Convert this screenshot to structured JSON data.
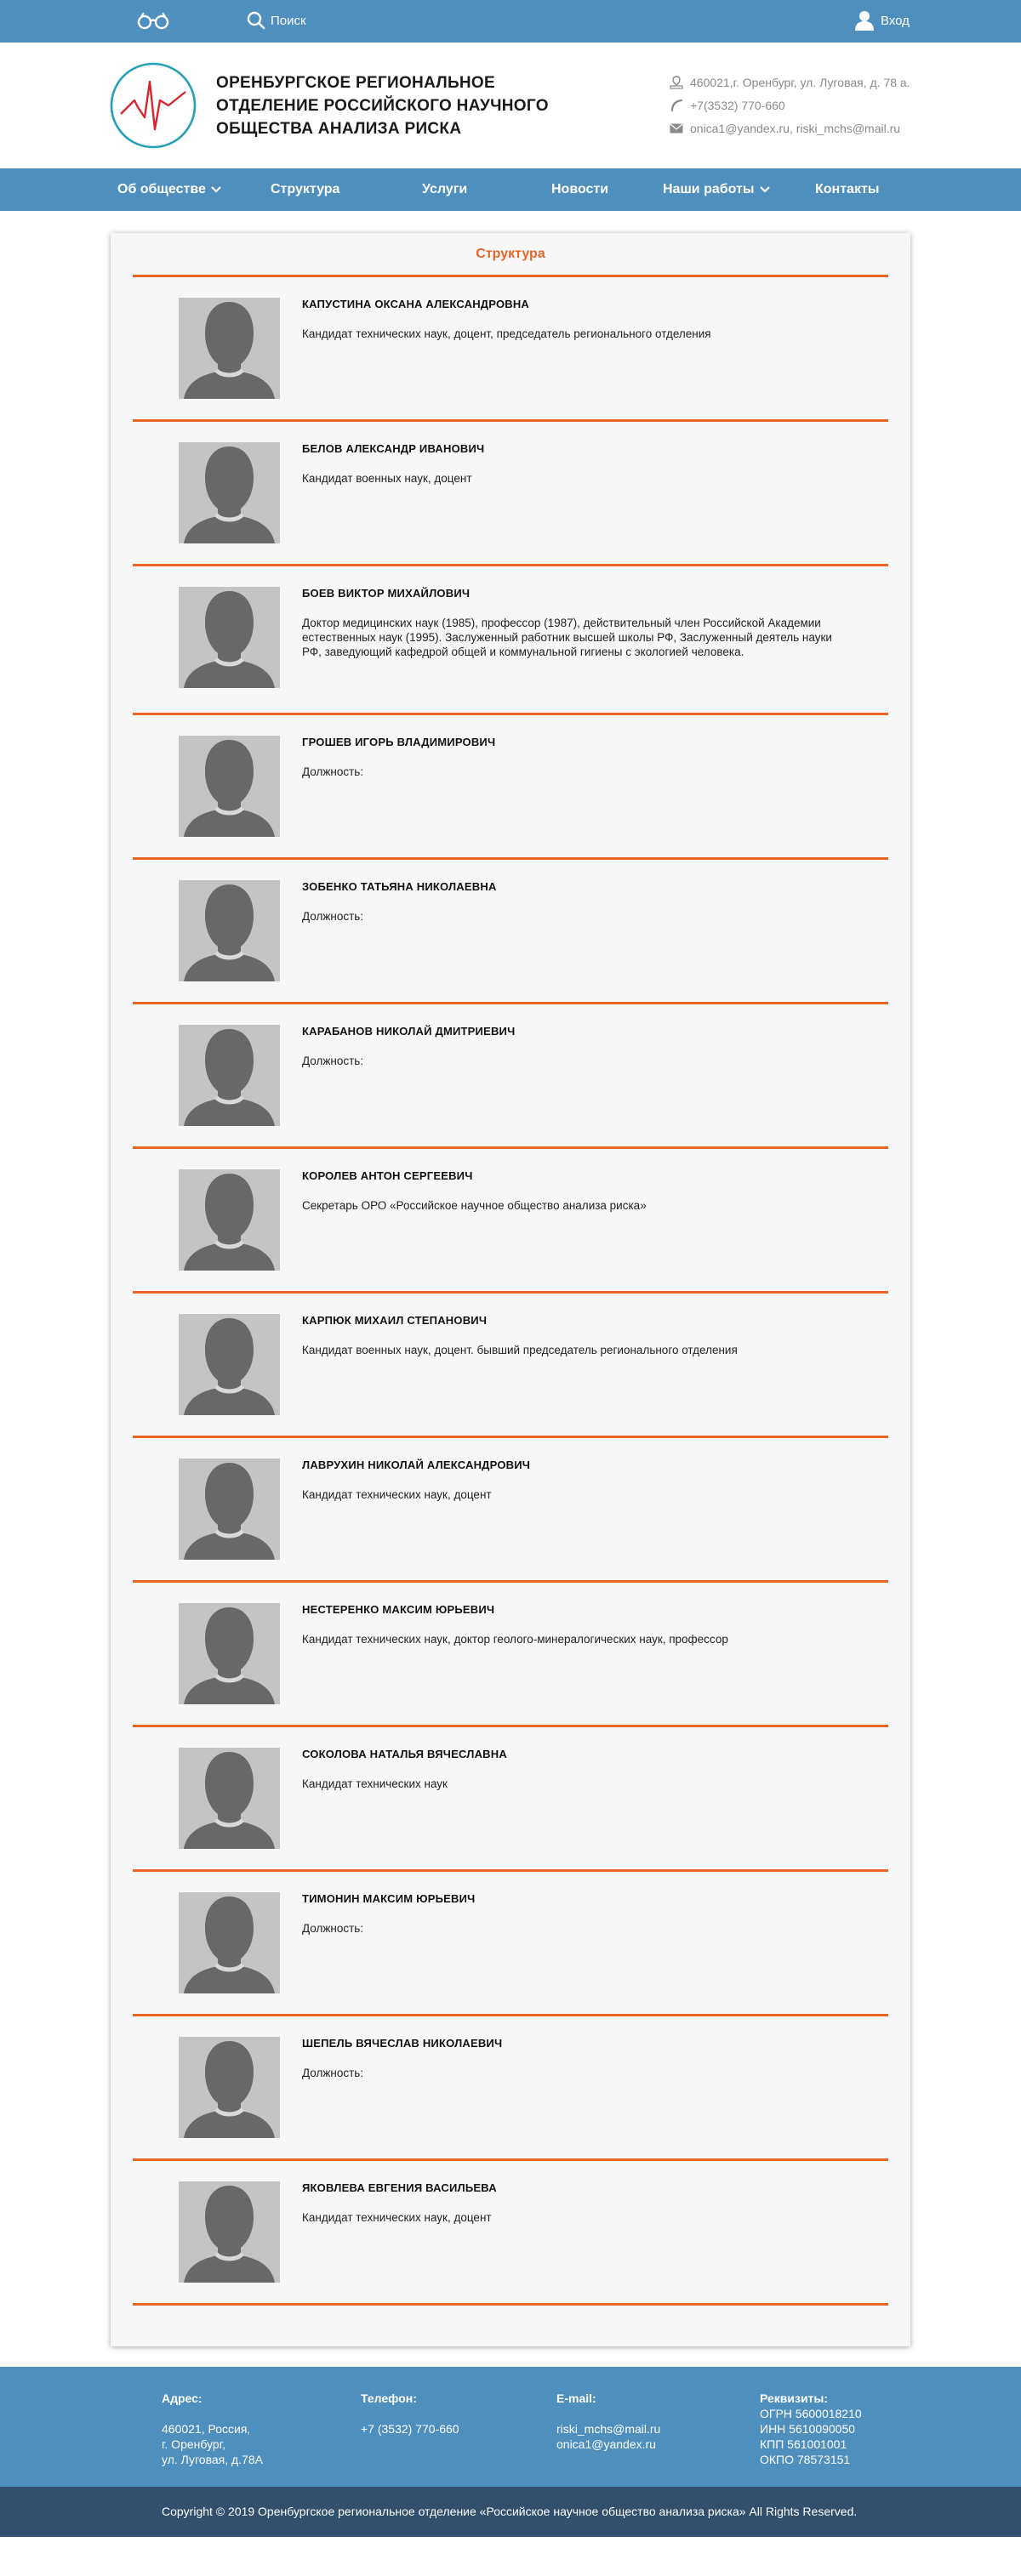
{
  "topbar": {
    "search_label": "Поиск",
    "login_label": "Вход"
  },
  "header": {
    "org_name": "ОРЕНБУРГСКОЕ РЕГИОНАЛЬНОЕ ОТДЕЛЕНИЕ РОССИЙСКОГО НАУЧНОГО ОБЩЕСТВА АНАЛИЗА РИСКА",
    "address": "460021,г. Оренбург, ул. Луговая, д. 78 а.",
    "phone": "+7(3532) 770-660",
    "emails": "onica1@yandex.ru, riski_mchs@mail.ru"
  },
  "nav": {
    "about": "Об обществе",
    "structure": "Структура",
    "services": "Услуги",
    "news": "Новости",
    "works": "Наши работы",
    "contacts": "Контакты"
  },
  "page": {
    "title": "Структура"
  },
  "people": [
    {
      "name": "КАПУСТИНА ОКСАНА АЛЕКСАНДРОВНА",
      "desc": "Кандидат технических наук, доцент, председатель регионального отделения"
    },
    {
      "name": "БЕЛОВ АЛЕКСАНДР ИВАНОВИЧ",
      "desc": "Кандидат военных наук, доцент"
    },
    {
      "name": "БОЕВ ВИКТОР МИХАЙЛОВИЧ",
      "desc": "Доктор медицинских наук (1985), профессор (1987), действительный член Российской Академии естественных наук (1995). Заслуженный работник высшей школы РФ, Заслуженный деятель науки РФ, заведующий кафедрой общей и коммунальной гигиены с экологией человека."
    },
    {
      "name": "ГРОШЕВ ИГОРЬ ВЛАДИМИРОВИЧ",
      "desc": "Должность:"
    },
    {
      "name": "ЗОБЕНКО ТАТЬЯНА НИКОЛАЕВНА",
      "desc": "Должность:"
    },
    {
      "name": "КАРАБАНОВ НИКОЛАЙ ДМИТРИЕВИЧ",
      "desc": "Должность:"
    },
    {
      "name": "КОРОЛЕВ АНТОН СЕРГЕЕВИЧ",
      "desc": "Секретарь ОРО «Российское научное общество анализа риска»"
    },
    {
      "name": "КАРПЮК МИХАИЛ СТЕПАНОВИЧ",
      "desc": "Кандидат военных наук, доцент. бывший председатель регионального отделения"
    },
    {
      "name": "ЛАВРУХИН НИКОЛАЙ АЛЕКСАНДРОВИЧ",
      "desc": "Кандидат технических наук, доцент"
    },
    {
      "name": "НЕСТЕРЕНКО МАКСИМ ЮРЬЕВИЧ",
      "desc": "Кандидат технических наук, доктор геолого-минералогических наук, профессор"
    },
    {
      "name": "СОКОЛОВА НАТАЛЬЯ ВЯЧЕСЛАВНА",
      "desc": "Кандидат технических наук"
    },
    {
      "name": "ТИМОНИН МАКСИМ ЮРЬЕВИЧ",
      "desc": "Должность:"
    },
    {
      "name": "ШЕПЕЛЬ ВЯЧЕСЛАВ НИКОЛАЕВИЧ",
      "desc": "Должность:"
    },
    {
      "name": "ЯКОВЛЕВА ЕВГЕНИЯ ВАСИЛЬЕВА",
      "desc": "Кандидат технических наук, доцент"
    }
  ],
  "footer": {
    "address_head": "Адрес:",
    "address_lines": [
      "460021, Россия,",
      "г. Оренбург,",
      "ул. Луговая, д.78А"
    ],
    "phone_head": "Телефон:",
    "phone": "+7 (3532) 770-660",
    "email_head": "E-mail:",
    "emails": [
      "riski_mchs@mail.ru",
      "onica1@yandex.ru"
    ],
    "req_head": "Реквизиты:",
    "req_lines": [
      "ОГРН 5600018210",
      "ИНН 5610090050",
      "КПП 561001001",
      "ОКПО 78573151"
    ],
    "copyright": "Copyright © 2019 Оренбургское региональное отделение «Российское научное общество анализа риска» All Rights Reserved."
  },
  "colors": {
    "brand_blue": "#4f8fbe",
    "accent_orange": "#e8652a",
    "footer_dark": "#30506e"
  }
}
